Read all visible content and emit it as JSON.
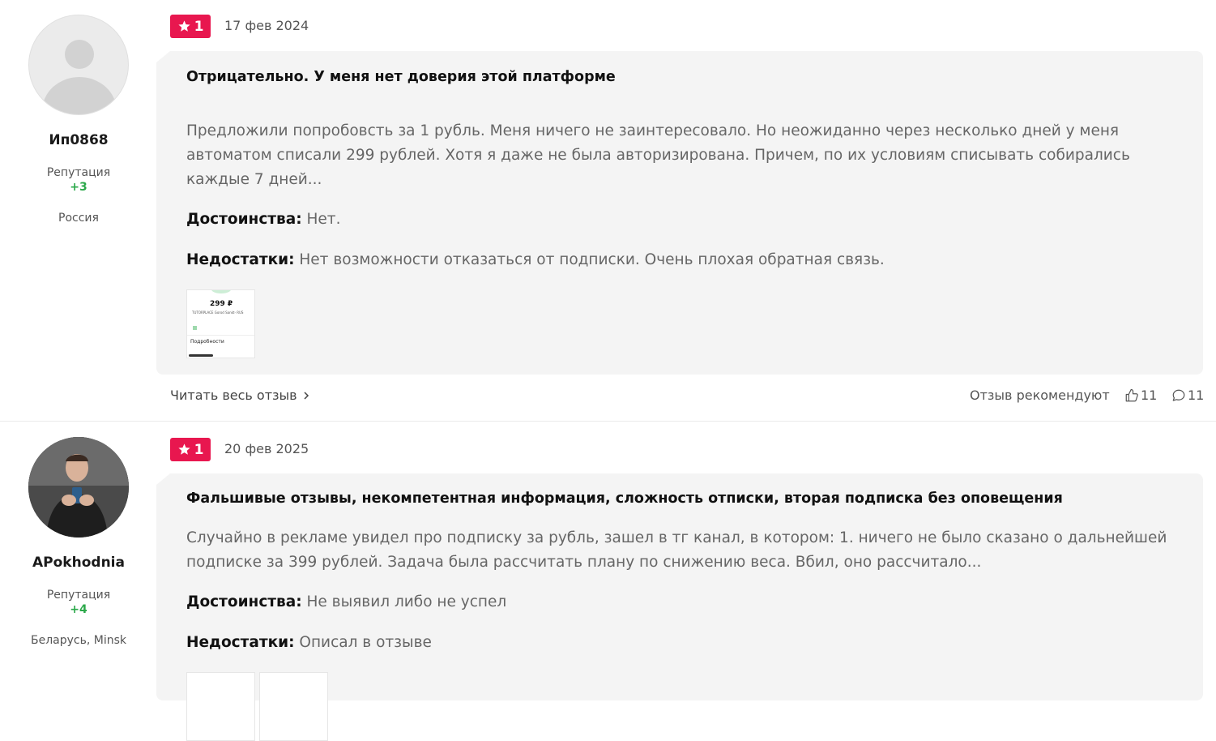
{
  "reviews": [
    {
      "author": {
        "name": "Ип0868",
        "reputation_label": "Репутация",
        "reputation": "+3",
        "location": "Россия",
        "avatar_icon": "default-user-icon"
      },
      "rating": "1",
      "date": "17 фев 2024",
      "title": "Отрицательно. У меня нет доверия этой платформе",
      "body": "Предложили попробовсть за 1 рубль. Меня ничего не заинтересовало. Но неожиданно через несколько дней у меня автоматом списали 299 рублей. Хотя я даже не была авторизирована. Причем, по их условиям списывать собирались каждые 7 дней...",
      "pros_label": "Достоинства:",
      "pros": "Нет.",
      "cons_label": "Недостатки:",
      "cons": "Нет возможности отказаться от подписки. Очень плохая обратная связь.",
      "thumbnail": {
        "amount": "299 ₽",
        "merchant": "TUTORPLACE Gorod Sankt- RUS",
        "details": "Подробности"
      },
      "read_more": "Читать весь отзыв",
      "recommend_label": "Отзыв рекомендуют",
      "likes": "11",
      "comments": "11"
    },
    {
      "author": {
        "name": "APokhodnia",
        "reputation_label": "Репутация",
        "reputation": "+4",
        "location": "Беларусь, Minsk",
        "avatar_icon": "user-photo"
      },
      "rating": "1",
      "date": "20 фев 2025",
      "title": "Фальшивые отзывы, некомпетентная информация, сложность отписки, вторая подписка без оповещения",
      "body": "Случайно в рекламе увидел про подписку за рубль, зашел в тг канал, в котором: 1. ничего не было сказано о дальнейшей подписке за 399 рублей. Задача была рассчитать плану по снижению веса. Вбил, оно рассчитало...",
      "pros_label": "Достоинства:",
      "pros": "Не выявил либо не успел",
      "cons_label": "Недостатки:",
      "cons": "Описал в отзыве"
    }
  ],
  "colors": {
    "rating_badge": "#e8174f",
    "reputation": "#2ba84a",
    "card_bg": "#f4f4f4"
  }
}
